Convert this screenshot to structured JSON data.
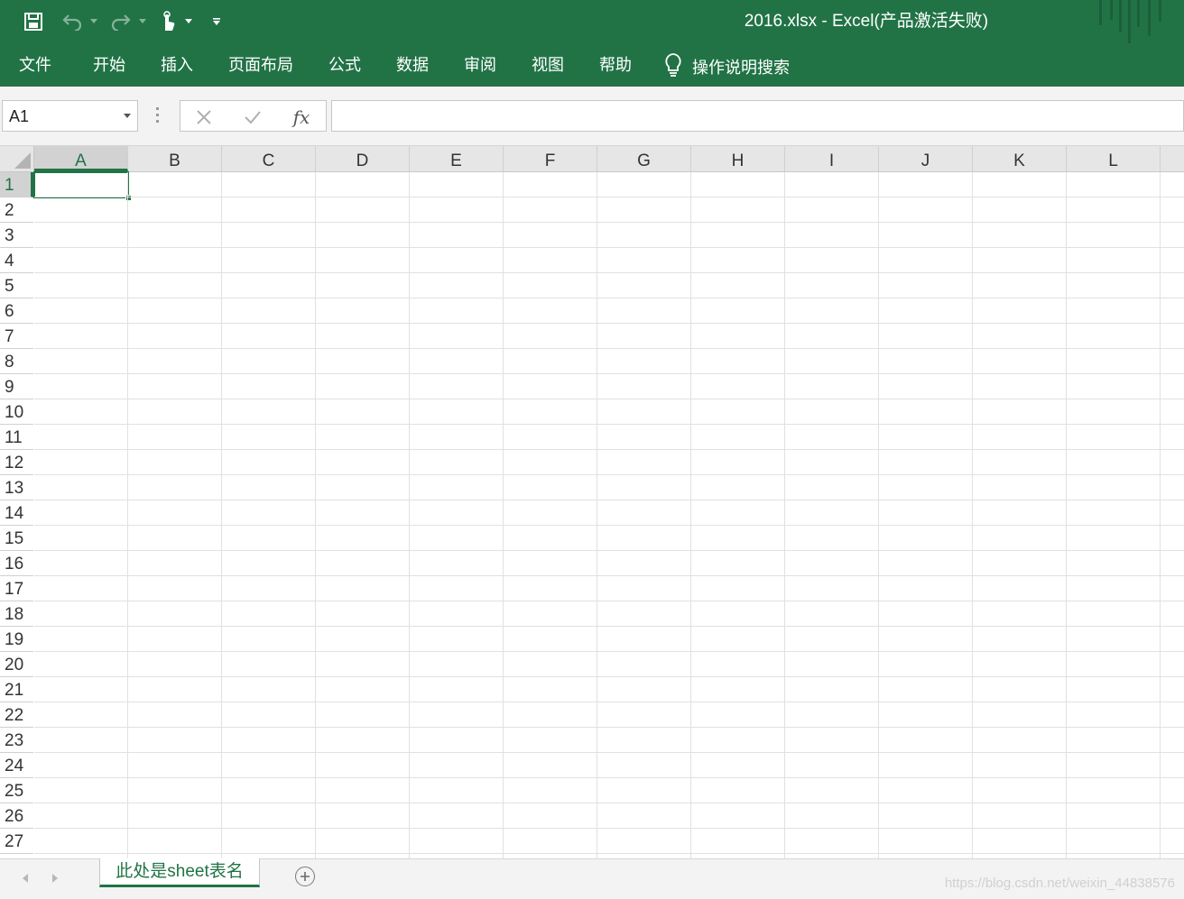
{
  "window": {
    "title": "2016.xlsx  -  Excel(产品激活失败)"
  },
  "quick_access": {
    "save_icon": "save-icon",
    "undo_icon": "undo-icon",
    "redo_icon": "redo-icon",
    "touch_mode_icon": "touch-mode-icon",
    "customize_icon": "customize-toolbar-icon"
  },
  "ribbon": {
    "tabs": [
      {
        "label": "文件"
      },
      {
        "label": "开始"
      },
      {
        "label": "插入"
      },
      {
        "label": "页面布局"
      },
      {
        "label": "公式"
      },
      {
        "label": "数据"
      },
      {
        "label": "审阅"
      },
      {
        "label": "视图"
      },
      {
        "label": "帮助"
      }
    ],
    "tell_me": {
      "icon": "lightbulb-icon",
      "label": "操作说明搜索"
    }
  },
  "formula_bar": {
    "name_box": "A1",
    "fx_label": "fx",
    "formula": ""
  },
  "grid": {
    "columns": [
      "A",
      "B",
      "C",
      "D",
      "E",
      "F",
      "G",
      "H",
      "I",
      "J",
      "K",
      "L"
    ],
    "rows": [
      "1",
      "2",
      "3",
      "4",
      "5",
      "6",
      "7",
      "8",
      "9",
      "10",
      "11",
      "12",
      "13",
      "14",
      "15",
      "16",
      "17",
      "18",
      "19",
      "20",
      "21",
      "22",
      "23",
      "24",
      "25",
      "26",
      "27"
    ],
    "selected_cell": "A1"
  },
  "sheet_tabs": {
    "tabs": [
      {
        "label": "此处是sheet表名"
      }
    ],
    "active_index": 0
  },
  "watermark": "https://blog.csdn.net/weixin_44838576",
  "colors": {
    "accent": "#217346",
    "header_bg": "#e6e6e6",
    "grid_line": "#e1e1e1"
  }
}
